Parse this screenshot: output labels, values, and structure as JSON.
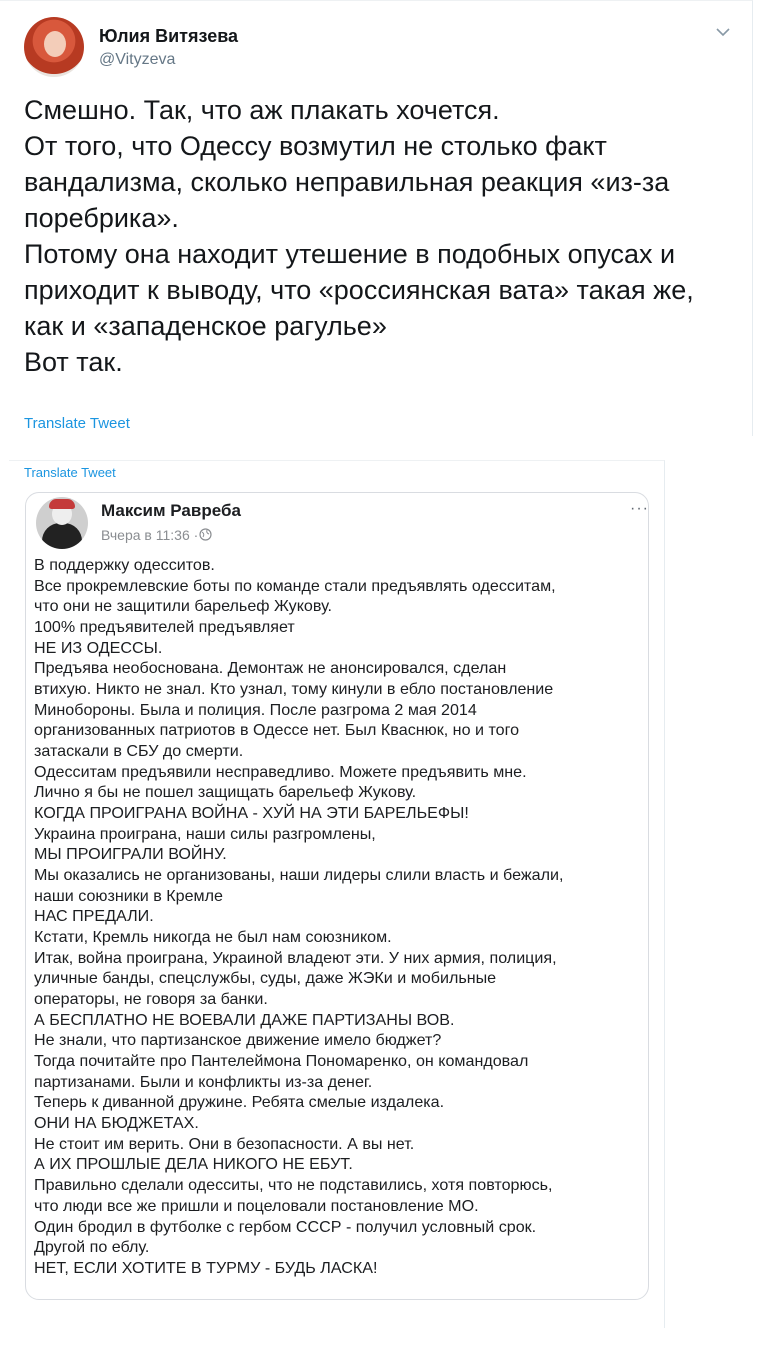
{
  "tweet": {
    "author_name": "Юлия Витязева",
    "author_handle": "@Vityzeva",
    "lines": [
      "Смешно. Так, что аж плакать хочется.",
      "От того, что Одессу возмутил не столько факт",
      "вандализма, сколько неправильная реакция «из-за",
      "поребрика».",
      "Потому она находит утешение в подобных опусах и",
      "приходит к выводу, что «россиянская вата» такая же,",
      "как и «западенское рагулье»",
      "Вот так."
    ],
    "translate_label": "Translate Tweet",
    "icons": {
      "menu": "chevron-down-icon",
      "avatar": "profile-photo"
    }
  },
  "embedded": {
    "translate_label": "Translate Tweet",
    "post": {
      "author_name": "Максим Равреба",
      "timestamp": "Вчера в 11:36 ·",
      "more_label": "···",
      "icons": {
        "privacy": "globe-icon",
        "more": "more-dots-icon"
      },
      "lines": [
        "В поддержку одесситов.",
        "Все прокремлевские боты по команде стали предъявлять одесситам,",
        "что они не защитили барельеф Жукову.",
        "100% предъявителей предъявляет",
        "НЕ ИЗ ОДЕССЫ.",
        "Предъява необоснована. Демонтаж не анонсировался, сделан",
        "втихую. Никто не знал. Кто узнал, тому кинули в ебло постановление",
        "Минобороны. Была и полиция. После разгрома 2 мая 2014",
        "организованных патриотов в Одессе нет. Был Квacнюк, но и того",
        "затаскали в СБУ до смерти.",
        "Одесситам предъявили несправедливо. Можете предъявить мне.",
        "Лично я бы не пошел защищать барельеф Жукову.",
        "КОГДА ПРОИГРАНА ВОЙНА - ХУЙ НА ЭТИ БАРЕЛЬЕФЫ!",
        "Украина проиграна, наши силы разгромлены,",
        "МЫ ПРОИГРАЛИ ВОЙНУ.",
        "Мы оказались не организованы, наши лидеры слили власть и бежали,",
        "наши союзники в Кремле",
        "НАС ПРЕДАЛИ.",
        "Кстати, Кремль никогда не был нам союзником.",
        "Итак, война проиграна, Украиной владеют эти. У них армия, полиция,",
        "уличные банды, спецслужбы, суды, даже ЖЭКи и мобильные",
        "операторы, не говоря за банки.",
        "А БЕСПЛАТНО НЕ ВОЕВАЛИ ДАЖЕ ПАРТИЗАНЫ ВОВ.",
        "Не знали, что партизанское движение имело бюджет?",
        "Тогда почитайте про Пантелеймона Пономаренко, он командовал",
        "партизанами. Были и конфликты из-за денег.",
        "Теперь к диванной дружине. Ребята смелые издалека.",
        "ОНИ НА БЮДЖЕТАХ.",
        "Не стоит им верить. Они в безопасности. А вы нет.",
        "А ИХ ПРОШЛЫЕ ДЕЛА НИКОГО НЕ ЕБУТ.",
        "Правильно сделали одесситы, что не подставились, хотя повторюсь,",
        "что люди все же пришли и поцеловали постановление МО.",
        "Один бродил в футболке с гербом СССР - получил условный срок.",
        "Другой по еблу.",
        "НЕТ, ЕСЛИ ХОТИТЕ В ТУРМУ - БУДЬ ЛАСКА!"
      ]
    }
  }
}
